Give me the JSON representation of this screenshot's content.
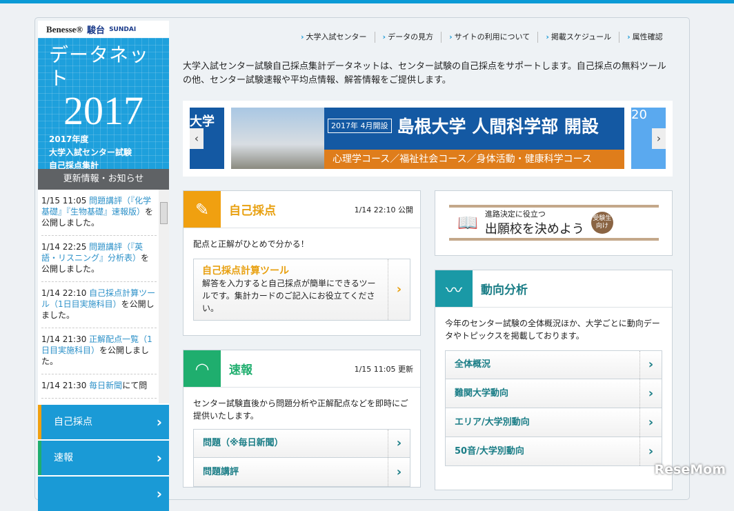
{
  "brand": {
    "benesse": "Benesse®",
    "sundai": "駿台",
    "sundai_en": "SUNDAI"
  },
  "hero": {
    "title": "データネット",
    "year": "2017",
    "line1": "2017年度",
    "line2": "大学入試センター試験",
    "line3": "自己採点集計"
  },
  "news": {
    "heading": "更新情報・お知らせ",
    "items": [
      {
        "time": "1/15 11:05 ",
        "link": "問題講評（『化学基礎』『生物基礎』速報版）",
        "rest": "を公開しました。"
      },
      {
        "time": "1/14 22:25 ",
        "link": "問題講評（『英語・リスニング』分析表）",
        "rest": "を公開しました。"
      },
      {
        "time": "1/14 22:10 ",
        "link": "自己採点計算ツール（1日目実施科目）",
        "rest": "を公開しました。"
      },
      {
        "time": "1/14 21:30 ",
        "link": "正解配点一覧（1日目実施科目）",
        "rest": "を公開しました。"
      },
      {
        "time": "1/14 21:30 ",
        "link": "毎日新聞",
        "rest": "にて問"
      }
    ]
  },
  "side_menu": [
    "自己採点",
    "速報"
  ],
  "nav": [
    "大学入試センター",
    "データの見方",
    "サイトの利用について",
    "掲載スケジュール",
    "属性確認"
  ],
  "intro": "大学入試センター試験自己採点集計データネットは、センター試験の自己採点をサポートします。自己採点の無料ツールの他、センター試験速報や平均点情報、解答情報をご提供します。",
  "banner": {
    "left": "大学",
    "box": "2017年 4月開設",
    "title": "島根大学 人間科学部 開設",
    "sub": "心理学コース／福祉社会コース／身体活動・健康科学コース",
    "right": "20"
  },
  "jiko": {
    "title": "自己採点",
    "date": "1/14 22:10 公開",
    "desc": "配点と正解がひとめで分かる！",
    "tool_title": "自己採点計算ツール",
    "tool_desc": "解答を入力すると自己採点が簡単にできるツールです。集計カードのご記入にお役立てください。"
  },
  "sokuho": {
    "title": "速報",
    "date": "1/15 11:05 更新",
    "desc": "センター試験直後から問題分析や正解配点などを即時にご提供いたします。",
    "items": [
      "問題（※毎日新聞）",
      "問題講評"
    ]
  },
  "ad": {
    "small": "進路決定に役立つ",
    "big": "出願校を決めよう",
    "badge": "受験生向け"
  },
  "trend": {
    "title": "動向分析",
    "desc": "今年のセンター試験の全体概況ほか、大学ごとに動向データやトピックスを掲載しております。",
    "items": [
      "全体概況",
      "難関大学動向",
      "エリア/大学別動向",
      "50音/大学別動向"
    ]
  },
  "watermark": "ReseMom"
}
